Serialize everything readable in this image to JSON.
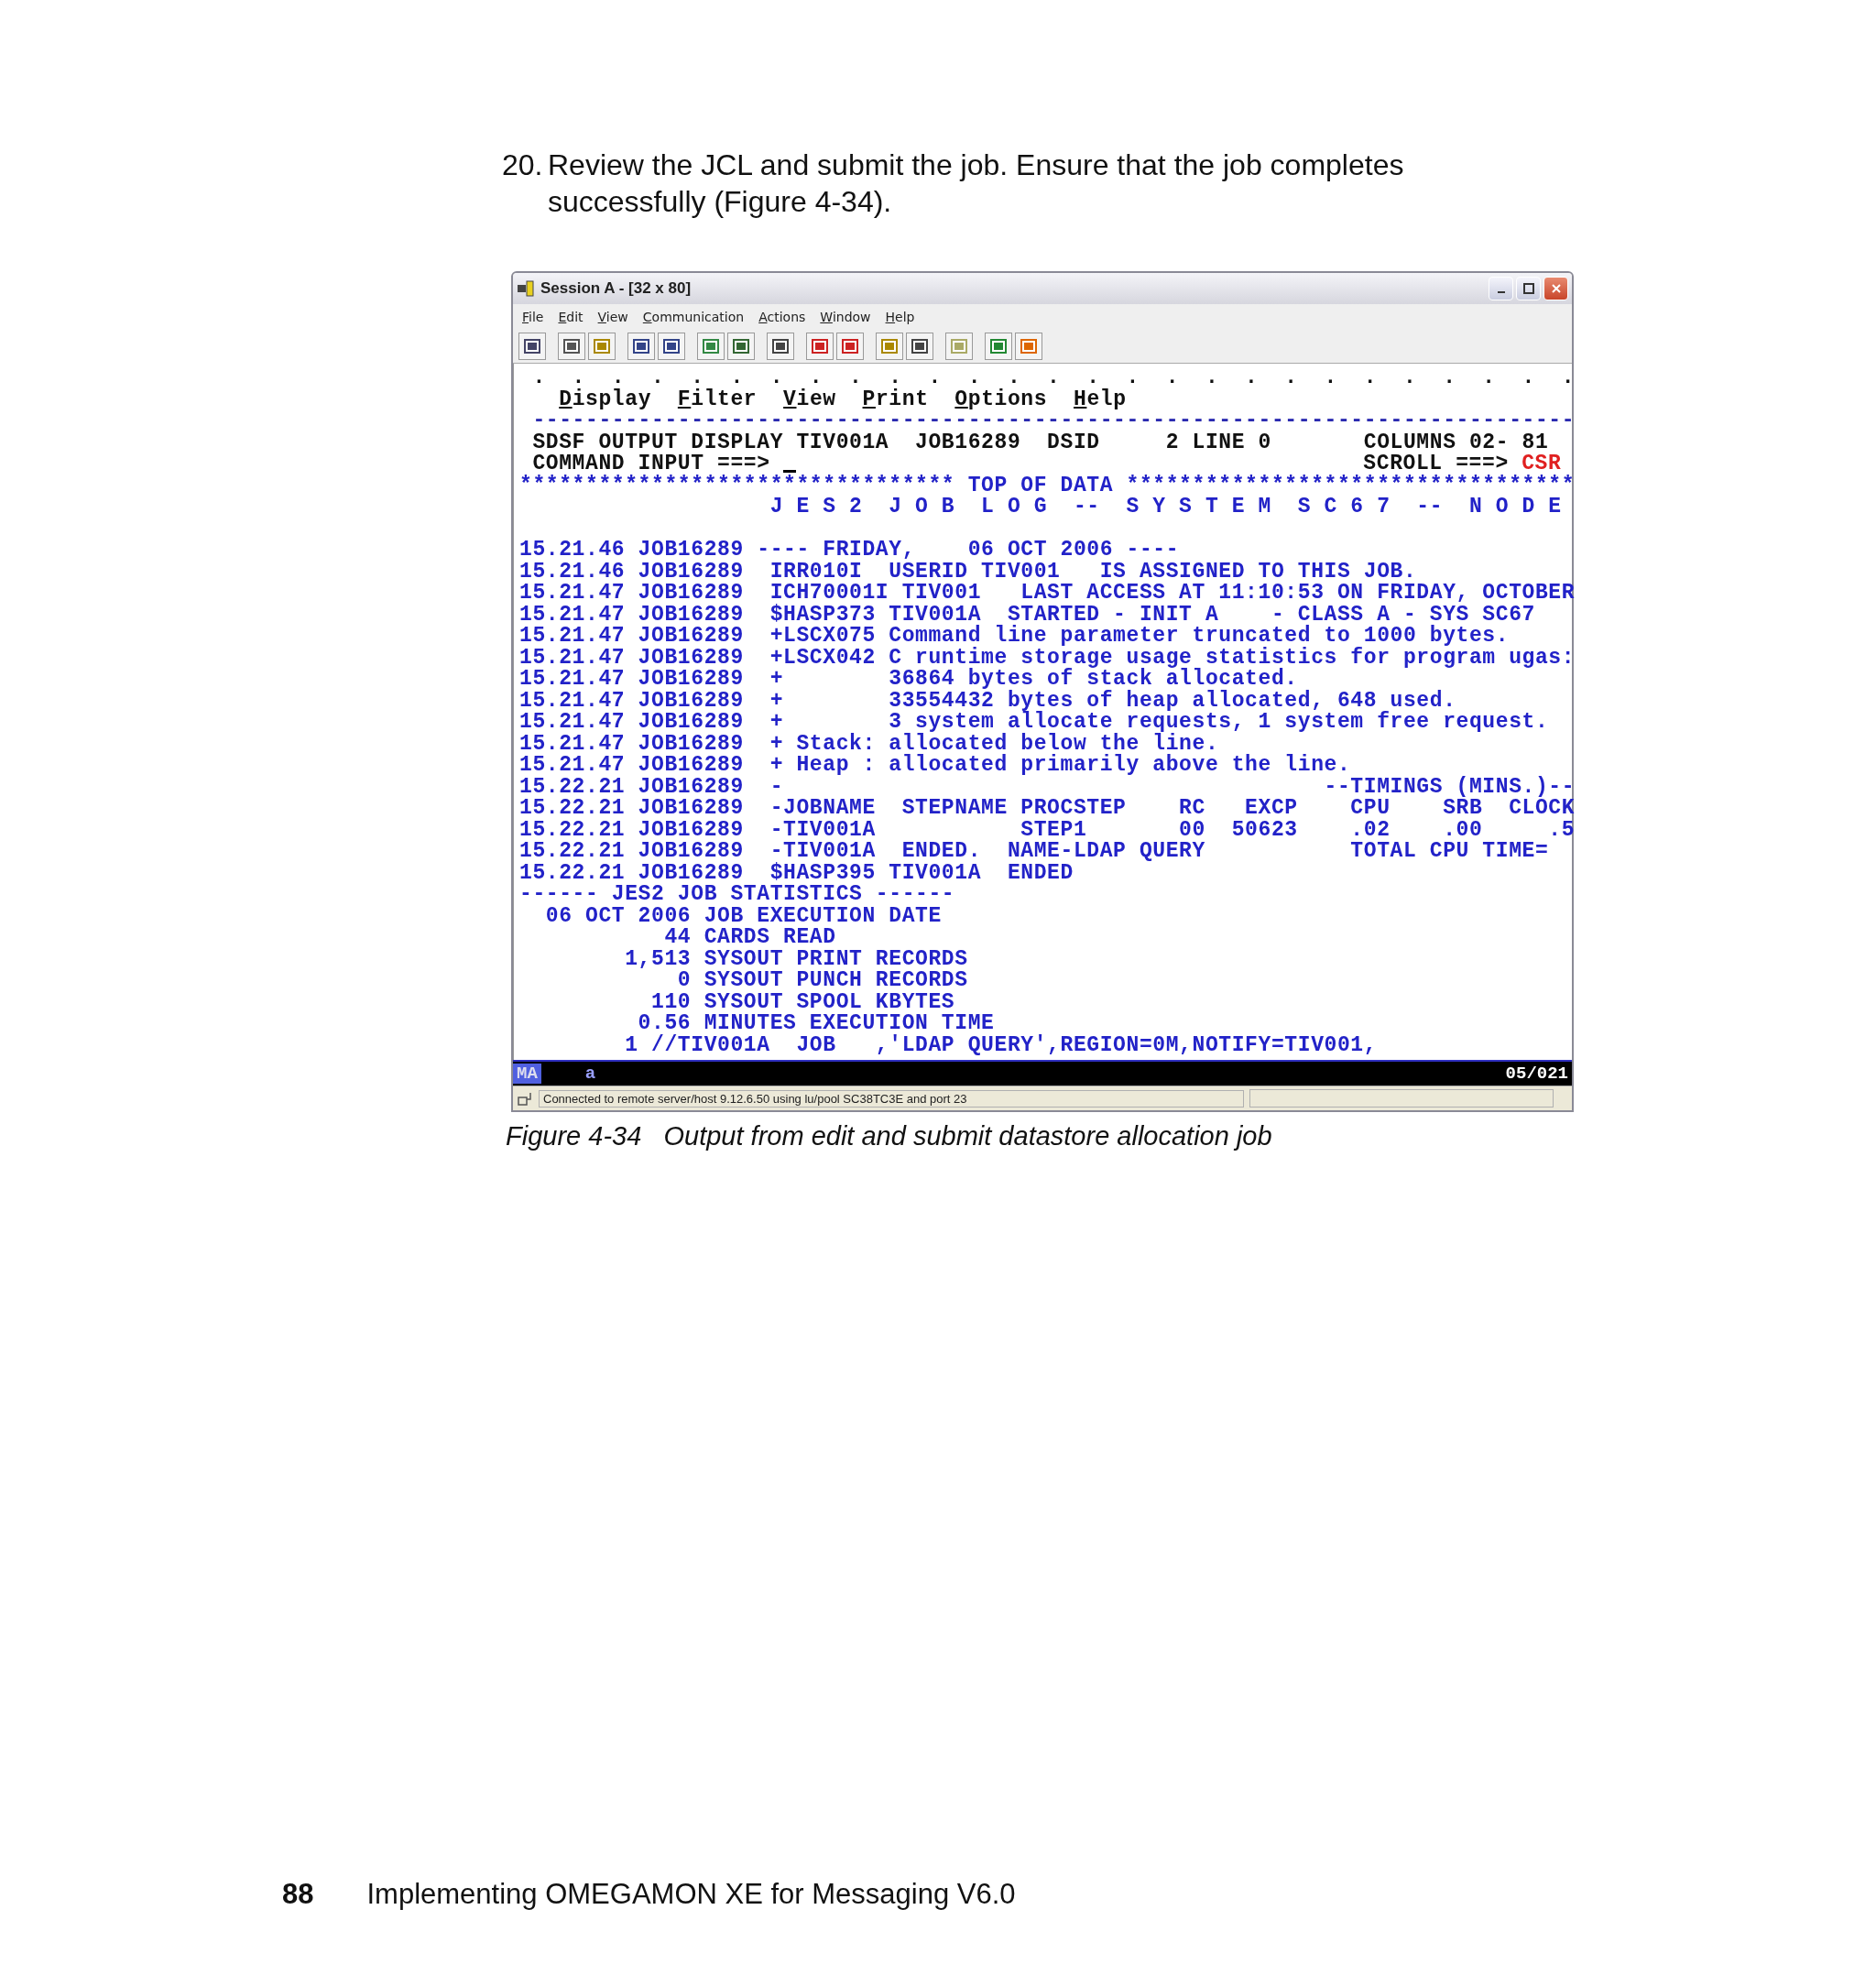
{
  "instruction": {
    "number": "20.",
    "text": "Review the JCL and submit the job. Ensure that the job completes successfully (Figure 4-34)."
  },
  "window": {
    "title": "Session A - [32 x 80]",
    "menu": [
      {
        "label": "File"
      },
      {
        "label": "Edit"
      },
      {
        "label": "View"
      },
      {
        "label": "Communication"
      },
      {
        "label": "Actions"
      },
      {
        "label": "Window"
      },
      {
        "label": "Help"
      }
    ],
    "terminal": {
      "lines": [
        {
          "kind": "dots",
          "text": " .  .  .  .  .  .  .  .  .  .  .  .  .  .  .  .  .  .  .  .  .  .  .  .  .  .  ."
        },
        {
          "kind": "actions",
          "items": [
            "Display",
            "Filter",
            "View",
            "Print",
            "Options",
            "Help"
          ]
        },
        {
          "kind": "rule",
          "text": " -------------------------------------------------------------------------------"
        },
        {
          "kind": "header",
          "text": " SDSF OUTPUT DISPLAY TIV001A  JOB16289  DSID     2 LINE 0       COLUMNS 02- 81"
        },
        {
          "kind": "command",
          "label": " COMMAND INPUT ===>",
          "scroll_label": "SCROLL ===>",
          "scroll_value": "CSR"
        },
        {
          "kind": "banner",
          "text": "********************************* TOP OF DATA **********************************"
        },
        {
          "kind": "log",
          "text": "                   J E S 2  J O B  L O G  --  S Y S T E M  S C 6 7  --  N O D E"
        },
        {
          "kind": "blank"
        },
        {
          "kind": "log",
          "text": "15.21.46 JOB16289 ---- FRIDAY,    06 OCT 2006 ----"
        },
        {
          "kind": "log",
          "text": "15.21.46 JOB16289  IRR010I  USERID TIV001   IS ASSIGNED TO THIS JOB."
        },
        {
          "kind": "log",
          "text": "15.21.47 JOB16289  ICH70001I TIV001   LAST ACCESS AT 11:10:53 ON FRIDAY, OCTOBER"
        },
        {
          "kind": "log",
          "text": "15.21.47 JOB16289  $HASP373 TIV001A  STARTED - INIT A    - CLASS A - SYS SC67"
        },
        {
          "kind": "log",
          "text": "15.21.47 JOB16289  +LSCX075 Command line parameter truncated to 1000 bytes."
        },
        {
          "kind": "log",
          "text": "15.21.47 JOB16289  +LSCX042 C runtime storage usage statistics for program ugas:"
        },
        {
          "kind": "log",
          "text": "15.21.47 JOB16289  +        36864 bytes of stack allocated."
        },
        {
          "kind": "log",
          "text": "15.21.47 JOB16289  +        33554432 bytes of heap allocated, 648 used."
        },
        {
          "kind": "log",
          "text": "15.21.47 JOB16289  +        3 system allocate requests, 1 system free request."
        },
        {
          "kind": "log",
          "text": "15.21.47 JOB16289  + Stack: allocated below the line."
        },
        {
          "kind": "log",
          "text": "15.21.47 JOB16289  + Heap : allocated primarily above the line."
        },
        {
          "kind": "log",
          "text": "15.22.21 JOB16289  -                                         --TIMINGS (MINS.)--"
        },
        {
          "kind": "log",
          "text": "15.22.21 JOB16289  -JOBNAME  STEPNAME PROCSTEP    RC   EXCP    CPU    SRB  CLOCK"
        },
        {
          "kind": "log",
          "text": "15.22.21 JOB16289  -TIV001A           STEP1       00  50623    .02    .00     .5"
        },
        {
          "kind": "log",
          "text": "15.22.21 JOB16289  -TIV001A  ENDED.  NAME-LDAP QUERY           TOTAL CPU TIME="
        },
        {
          "kind": "log",
          "text": "15.22.21 JOB16289  $HASP395 TIV001A  ENDED"
        },
        {
          "kind": "log",
          "text": "------ JES2 JOB STATISTICS ------"
        },
        {
          "kind": "log",
          "text": "  06 OCT 2006 JOB EXECUTION DATE"
        },
        {
          "kind": "log",
          "text": "           44 CARDS READ"
        },
        {
          "kind": "log",
          "text": "        1,513 SYSOUT PRINT RECORDS"
        },
        {
          "kind": "log",
          "text": "            0 SYSOUT PUNCH RECORDS"
        },
        {
          "kind": "log",
          "text": "          110 SYSOUT SPOOL KBYTES"
        },
        {
          "kind": "log",
          "text": "         0.56 MINUTES EXECUTION TIME"
        },
        {
          "kind": "log",
          "text": "        1 //TIV001A  JOB   ,'LDAP QUERY',REGION=0M,NOTIFY=TIV001,"
        }
      ]
    },
    "oia": {
      "left": "MA",
      "center": "a",
      "right": "05/021"
    },
    "status_bar": {
      "text": "Connected to remote server/host 9.12.6.50 using lu/pool SC38TC3E and port 23"
    }
  },
  "caption": {
    "label": "Figure 4-34",
    "title": "Output from edit and submit datastore allocation job"
  },
  "footer": {
    "page_number": "88",
    "title": "Implementing OMEGAMON XE for Messaging V6.0"
  }
}
